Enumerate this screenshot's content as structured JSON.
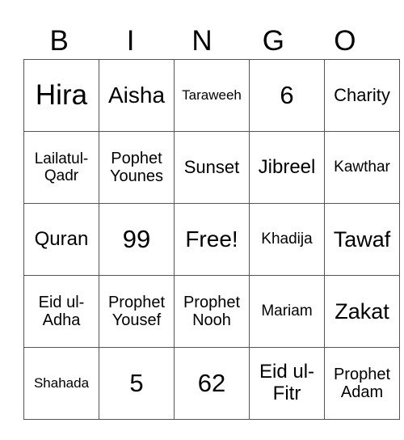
{
  "header": {
    "letters": [
      "B",
      "I",
      "N",
      "G",
      "O"
    ]
  },
  "grid": {
    "rows": [
      [
        "Hira",
        "Aisha",
        "Taraweeh",
        "6",
        "Charity"
      ],
      [
        "Lailatul-Qadr",
        "Pophet Younes",
        "Sunset",
        "Jibreel",
        "Kawthar"
      ],
      [
        "Quran",
        "99",
        "Free!",
        "Khadija",
        "Tawaf"
      ],
      [
        "Eid ul-Adha",
        "Prophet Yousef",
        "Prophet Nooh",
        "Mariam",
        "Zakat"
      ],
      [
        "Shahada",
        "5",
        "62",
        "Eid ul-Fitr",
        "Prophet Adam"
      ]
    ]
  }
}
